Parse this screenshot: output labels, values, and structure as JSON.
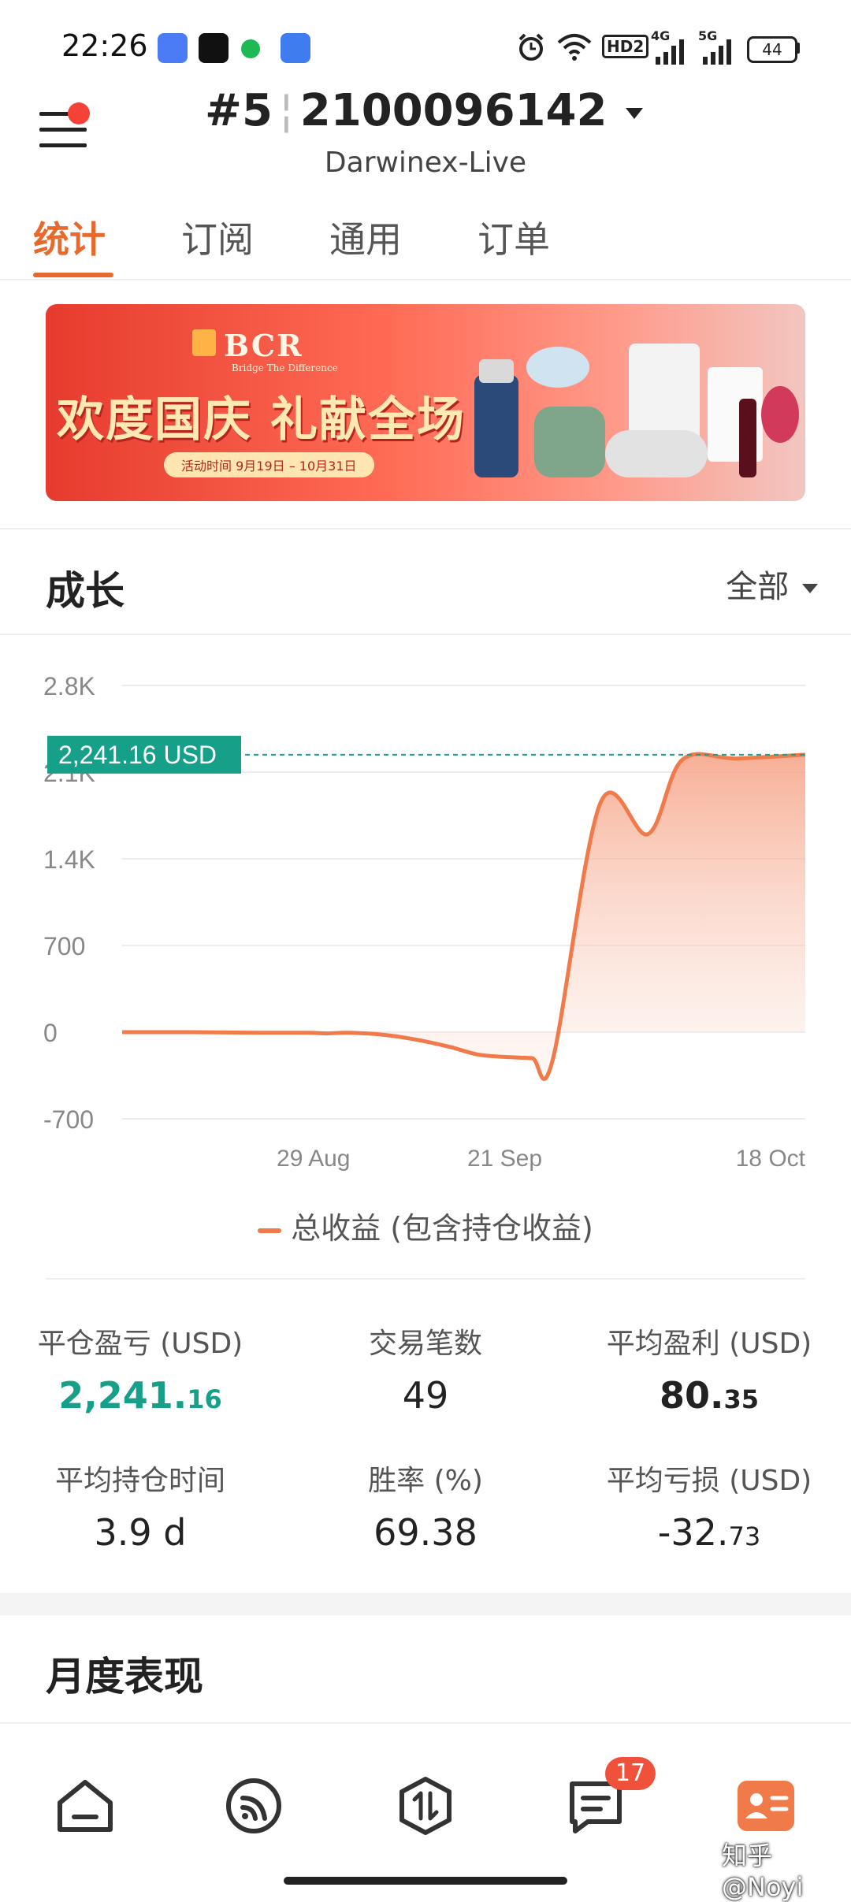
{
  "status_bar": {
    "time": "22:26",
    "icons": [
      "qq-icon",
      "tiktok-icon",
      "spotify-icon",
      "app-icon",
      "alarm-icon",
      "wifi-icon",
      "hd-icon",
      "signal-4g-icon",
      "signal-5g-icon"
    ],
    "hd": "HD2",
    "net1": "4G",
    "net2": "5G",
    "battery": "44"
  },
  "header": {
    "account_prefix": "#5",
    "account_number": "2100096142",
    "server": "Darwinex-Live"
  },
  "tabs": [
    {
      "label": "统计",
      "active": true
    },
    {
      "label": "订阅",
      "active": false
    },
    {
      "label": "通用",
      "active": false
    },
    {
      "label": "订单",
      "active": false
    }
  ],
  "banner": {
    "brand": "BCR",
    "brand_sub": "Bridge The Difference",
    "title": "欢度国庆 礼献全场",
    "date": "活动时间 9月19日 – 10月31日"
  },
  "growth": {
    "title": "成长",
    "filter": "全部",
    "current_label": "2,241.16 USD",
    "legend": "总收益 (包含持仓收益)"
  },
  "chart_data": {
    "type": "area",
    "ylim": [
      -700,
      2800
    ],
    "yticks": [
      "2.8K",
      "2.1K",
      "1.4K",
      "700",
      "0",
      "-700"
    ],
    "xticks": [
      "29 Aug",
      "21 Sep",
      "18 Oct"
    ],
    "current_value": 2241.16,
    "series": [
      {
        "name": "总收益 (包含持仓收益)",
        "color": "#f07a4a",
        "values": [
          0,
          0,
          -5,
          -5,
          -10,
          -5,
          -20,
          -60,
          -120,
          -180,
          -200,
          -210,
          -230,
          1850,
          1600,
          2200,
          2210,
          2241.16
        ]
      }
    ]
  },
  "stats": [
    {
      "label": "平仓盈亏 (USD)",
      "int": "2,241.",
      "dec": "16",
      "green": true
    },
    {
      "label": "交易笔数",
      "int": "49",
      "dec": "",
      "green": false
    },
    {
      "label": "平均盈利 (USD)",
      "int": "80.",
      "dec": "35",
      "green": false
    },
    {
      "label": "平均持仓时间",
      "int": "3.9 d",
      "dec": "",
      "green": false
    },
    {
      "label": "胜率 (%)",
      "int": "69.38",
      "dec": "",
      "green": false
    },
    {
      "label": "平均亏损 (USD)",
      "int": "-32.",
      "dec": "73",
      "green": false
    }
  ],
  "monthly": {
    "title": "月度表现"
  },
  "nav": {
    "items": [
      "home-icon",
      "feed-icon",
      "trade-icon",
      "messages-icon",
      "profile-icon"
    ],
    "badge": "17"
  },
  "watermark": "知乎 @Noyi"
}
